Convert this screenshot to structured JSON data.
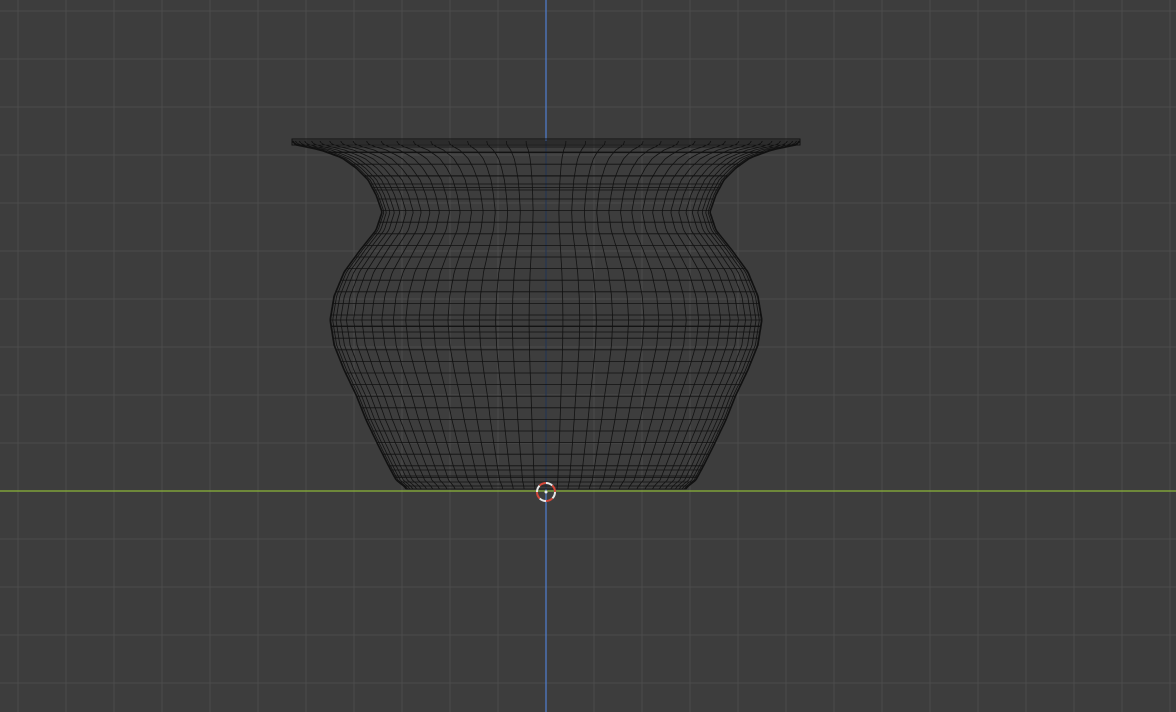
{
  "viewport": {
    "view": "front-orthographic",
    "shading": "wireframe",
    "colors": {
      "background": "#3d3d3d",
      "grid_minor": "#4b4b4b",
      "grid_major": "#575757",
      "x_axis": "#8cb53a",
      "z_axis": "#4f7fd1",
      "wire": "#111111",
      "cursor_ring": "#e8e8e8",
      "cursor_accent": "#d6483a"
    },
    "icons": {
      "cursor": "3d-cursor-icon",
      "object": "vase-icon"
    },
    "object": {
      "type": "mesh",
      "shape": "vase",
      "wire_rings": 30,
      "wire_segments": 40
    }
  }
}
